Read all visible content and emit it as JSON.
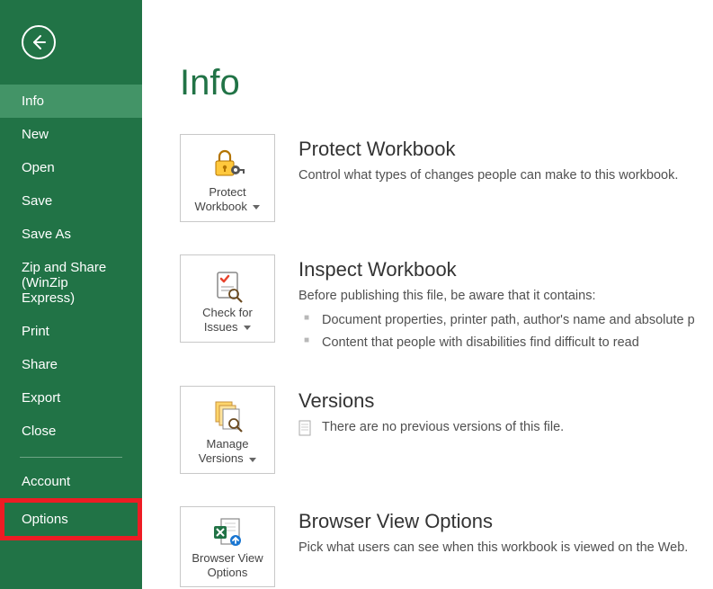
{
  "sidebar": {
    "items": [
      {
        "label": "Info",
        "selected": true
      },
      {
        "label": "New"
      },
      {
        "label": "Open"
      },
      {
        "label": "Save"
      },
      {
        "label": "Save As"
      },
      {
        "label": "Zip and Share (WinZip Express)"
      },
      {
        "label": "Print"
      },
      {
        "label": "Share"
      },
      {
        "label": "Export"
      },
      {
        "label": "Close"
      }
    ],
    "footer_items": [
      {
        "label": "Account"
      },
      {
        "label": "Options",
        "highlighted": true
      }
    ]
  },
  "main": {
    "title": "Info",
    "sections": {
      "protect": {
        "tile_label_1": "Protect",
        "tile_label_2": "Workbook",
        "title": "Protect Workbook",
        "text": "Control what types of changes people can make to this workbook."
      },
      "inspect": {
        "tile_label_1": "Check for",
        "tile_label_2": "Issues",
        "title": "Inspect Workbook",
        "intro": "Before publishing this file, be aware that it contains:",
        "bullets": [
          "Document properties, printer path, author's name and absolute p",
          "Content that people with disabilities find difficult to read"
        ]
      },
      "versions": {
        "tile_label_1": "Manage",
        "tile_label_2": "Versions",
        "title": "Versions",
        "text": "There are no previous versions of this file."
      },
      "browser": {
        "tile_label_1": "Browser View",
        "tile_label_2": "Options",
        "title": "Browser View Options",
        "text": "Pick what users can see when this workbook is viewed on the Web."
      }
    }
  }
}
